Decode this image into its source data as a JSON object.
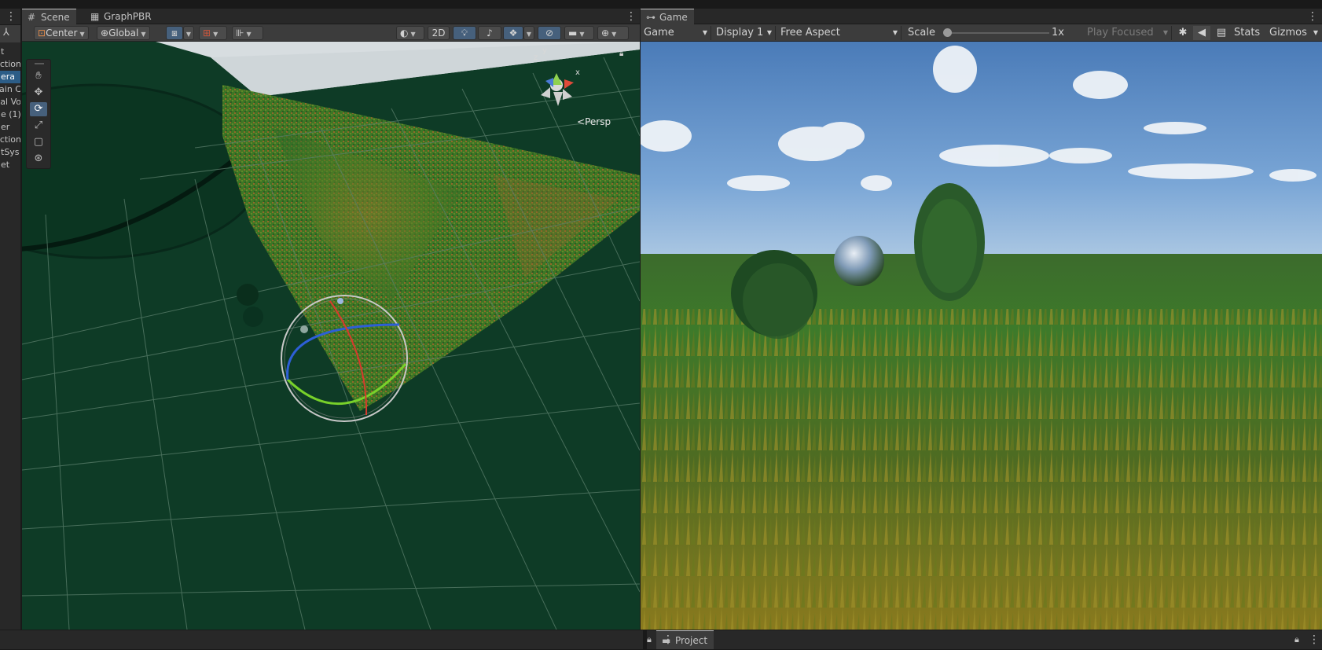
{
  "hierarchy": {
    "rows": [
      {
        "label": "t",
        "selected": false
      },
      {
        "label": "ection",
        "selected": false
      },
      {
        "label": "era",
        "selected": true
      },
      {
        "label": "ain C",
        "selected": false
      },
      {
        "label": "al Vo",
        "selected": false
      },
      {
        "label": "e (1)",
        "selected": false
      },
      {
        "label": "er",
        "selected": false
      },
      {
        "label": "ection",
        "selected": false
      },
      {
        "label": "tSys",
        "selected": false
      },
      {
        "label": "et",
        "selected": false
      }
    ]
  },
  "scene": {
    "tabs": [
      {
        "label": "Scene",
        "icon": "hash-icon"
      },
      {
        "label": "GraphPBR",
        "icon": "graph-icon"
      }
    ],
    "toolbar": {
      "pivot_label": "Center",
      "space_label": "Global",
      "mode_2d_label": "2D"
    },
    "tools": [
      "hand-icon",
      "move-icon",
      "rotate-icon",
      "scale-icon",
      "rect-icon",
      "transform-icon"
    ],
    "active_tool": 2,
    "projection_label": "Persp",
    "gizmo_axes": {
      "y": "y",
      "z": "z",
      "x": "x"
    }
  },
  "game": {
    "tab_label": "Game",
    "toolbar": {
      "view_select": "Game",
      "display_select": "Display 1",
      "aspect_select": "Free Aspect",
      "scale_label": "Scale",
      "scale_value": "1x",
      "scale_fraction": 0.0,
      "play_mode": "Play Focused",
      "stats_label": "Stats",
      "gizmos_label": "Gizmos"
    }
  },
  "bottom": {
    "project_label": "Project"
  },
  "colors": {
    "selection": "#2c5d87",
    "active_tool": "#46607c",
    "scene_ground": "#0e3b26",
    "sky_top": "#4a7bb8"
  }
}
